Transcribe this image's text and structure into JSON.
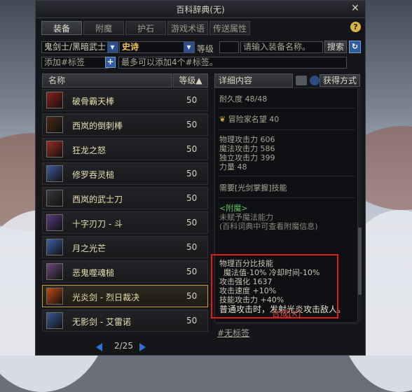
{
  "window": {
    "title": "百科辞典(无)",
    "close": "✕"
  },
  "tabs": [
    {
      "label": "装备",
      "active": true
    },
    {
      "label": "附魔"
    },
    {
      "label": "护石"
    },
    {
      "label": "游戏术语"
    },
    {
      "label": "传送属性"
    }
  ],
  "help_label": "?",
  "filters": {
    "job": "鬼剑士/黑暗武士",
    "rarity": "史诗",
    "level_label": "等级",
    "level_value": "",
    "name_placeholder": "请输入装备名称。",
    "search_label": "搜索",
    "tag_placeholder": "添加#标签",
    "tag_hint": "最多可以添加4个#标签。"
  },
  "list": {
    "col_name": "名称",
    "col_level": "等级▲",
    "items": [
      {
        "name": "破骨霸天棒",
        "level": "50",
        "icon": "club-icon",
        "color": "#8c2018"
      },
      {
        "name": "西岚的倒刺棒",
        "level": "50",
        "icon": "rod-icon",
        "color": "#4a2a16"
      },
      {
        "name": "狂龙之怒",
        "level": "50",
        "icon": "dragon-blade-icon",
        "color": "#9a2d20"
      },
      {
        "name": "修罗吞灵槌",
        "level": "50",
        "icon": "hammer-icon",
        "color": "#3e5c9a"
      },
      {
        "name": "西岚的武士刀",
        "level": "50",
        "icon": "katana-icon",
        "color": "#3a3a40"
      },
      {
        "name": "十字刃刀 - 斗",
        "level": "50",
        "icon": "cross-blade-icon",
        "color": "#5a3a80"
      },
      {
        "name": "月之光芒",
        "level": "50",
        "icon": "moonlight-sword-icon",
        "color": "#3a62a8"
      },
      {
        "name": "恶鬼噬魂槌",
        "level": "50",
        "icon": "mace-icon",
        "color": "#6a4a7a"
      },
      {
        "name": "光炎剑 - 烈日裁决",
        "level": "50",
        "icon": "flame-sword-icon",
        "color": "#c04a16",
        "selected": true
      },
      {
        "name": "无影剑 - 艾雷诺",
        "level": "50",
        "icon": "shadow-sword-icon",
        "color": "#3a5a9a"
      }
    ]
  },
  "pager": {
    "text": "2/25"
  },
  "detail": {
    "tab_label": "详细内容",
    "acquire_label": "获得方式",
    "durability": "耐久度 48/48",
    "adventurer_fame": "冒险家名望 40",
    "stats": [
      "物理攻击力 606",
      "魔法攻击力 586",
      "独立攻击力 399",
      "力量 48"
    ],
    "requirement": "需要[光剑掌握]技能",
    "enchant_title": "<附魔>",
    "enchant_lines": [
      "未赋予魔法能力",
      "(百科词典中可查看附魔信息)"
    ],
    "effects": [
      "物理百分比技能",
      "魔法值-10% 冷却时间-10%",
      "攻击强化 1637",
      "攻击速度 +10%",
      "技能攻击力 +40%",
      "普通攻击时，发射光炎攻击敌人。"
    ],
    "synthesis": "合成[X]",
    "no_tag": "#无标签"
  }
}
